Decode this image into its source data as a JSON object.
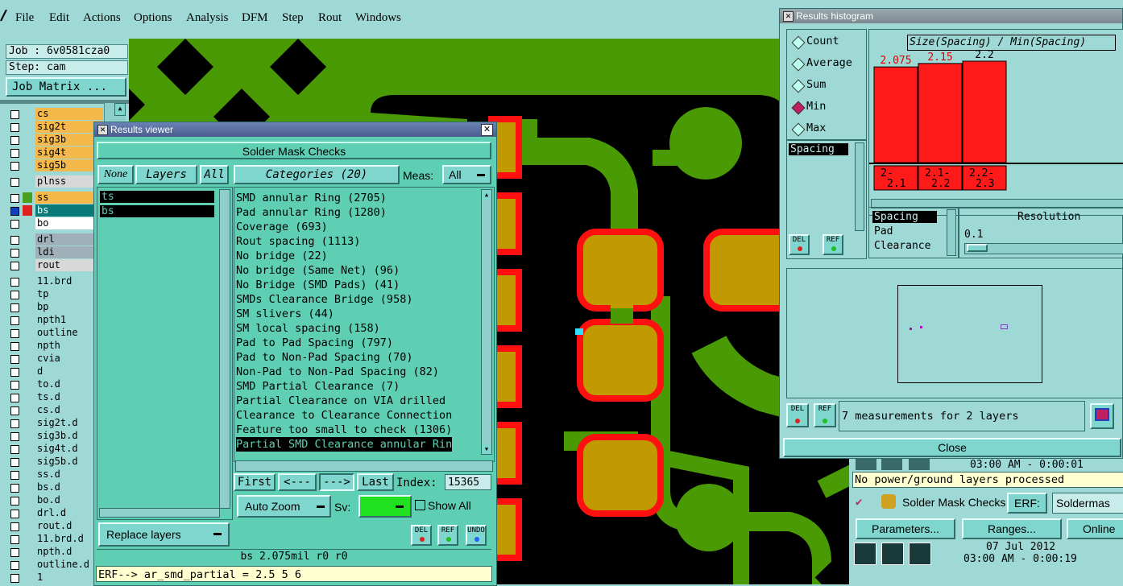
{
  "menubar": {
    "items": [
      "File",
      "Edit",
      "Actions",
      "Options",
      "Analysis",
      "DFM",
      "Step",
      "Rout",
      "Windows"
    ]
  },
  "left_panel": {
    "job": "Job : 6v0581cza0",
    "step": "Step: cam",
    "job_matrix": "Job Matrix ...",
    "layers": [
      {
        "name": "cs",
        "bg": "#f5b84a"
      },
      {
        "name": "sig2t",
        "bg": "#f5b84a"
      },
      {
        "name": "sig3b",
        "bg": "#f5b84a"
      },
      {
        "name": "sig4t",
        "bg": "#f5b84a"
      },
      {
        "name": "sig5b",
        "bg": "#f5b84a"
      },
      {
        "name": "plnss",
        "bg": "#d8d8d8"
      },
      {
        "name": "ss",
        "bg": "#f5b84a",
        "swatch": "#4aa020"
      },
      {
        "name": "bs",
        "bg": "#0a7a78",
        "swatch": "#e02020"
      },
      {
        "name": "bo",
        "bg": "#ffffff"
      },
      {
        "name": "drl",
        "bg": "#a0b0b8"
      },
      {
        "name": "ldi",
        "bg": "#a0b0b8"
      },
      {
        "name": "rout",
        "bg": "#d8d8d8"
      },
      {
        "name": "11.brd",
        "bg": "#9ed9d6"
      },
      {
        "name": "tp",
        "bg": "#9ed9d6"
      },
      {
        "name": "bp",
        "bg": "#9ed9d6"
      },
      {
        "name": "npth1",
        "bg": "#9ed9d6"
      },
      {
        "name": "outline",
        "bg": "#9ed9d6"
      },
      {
        "name": "npth",
        "bg": "#9ed9d6"
      },
      {
        "name": "cvia",
        "bg": "#9ed9d6"
      },
      {
        "name": "d",
        "bg": "#9ed9d6"
      },
      {
        "name": "to.d",
        "bg": "#9ed9d6"
      },
      {
        "name": "ts.d",
        "bg": "#9ed9d6"
      },
      {
        "name": "cs.d",
        "bg": "#9ed9d6"
      },
      {
        "name": "sig2t.d",
        "bg": "#9ed9d6"
      },
      {
        "name": "sig3b.d",
        "bg": "#9ed9d6"
      },
      {
        "name": "sig4t.d",
        "bg": "#9ed9d6"
      },
      {
        "name": "sig5b.d",
        "bg": "#9ed9d6"
      },
      {
        "name": "ss.d",
        "bg": "#9ed9d6"
      },
      {
        "name": "bs.d",
        "bg": "#9ed9d6"
      },
      {
        "name": "bo.d",
        "bg": "#9ed9d6"
      },
      {
        "name": "drl.d",
        "bg": "#9ed9d6"
      },
      {
        "name": "rout.d",
        "bg": "#9ed9d6"
      },
      {
        "name": "11.brd.d",
        "bg": "#9ed9d6"
      },
      {
        "name": "npth.d",
        "bg": "#9ed9d6"
      },
      {
        "name": "outline.d",
        "bg": "#9ed9d6"
      },
      {
        "name": "1",
        "bg": "#9ed9d6"
      }
    ]
  },
  "results_viewer": {
    "title": "Results viewer",
    "header": "Solder Mask Checks",
    "none_btn": "None",
    "layers_btn": "Layers",
    "all_btn": "All",
    "layers": [
      "ts",
      "bs"
    ],
    "categories_btn": "Categories (20)",
    "meas_label": "Meas:",
    "meas_value": "All",
    "categories": [
      "SMD annular Ring (2705)",
      "Pad annular Ring (1280)",
      "Coverage (693)",
      "Rout spacing (1113)",
      "No bridge (22)",
      "No bridge (Same Net) (96)",
      "No Bridge (SMD Pads) (41)",
      "SMDs Clearance Bridge (958)",
      "SM slivers (44)",
      "SM local spacing (158)",
      "Pad to Pad Spacing (797)",
      "Pad to Non-Pad Spacing (70)",
      "Non-Pad to Non-Pad Spacing (82)",
      "SMD Partial Clearance (7)",
      "Partial Clearance on VIA drilled",
      "Clearance to Clearance Connection",
      "Feature too small to check (1306)",
      "Partial SMD Clearance annular Rin"
    ],
    "first": "First",
    "prev": "<---",
    "next": "--->",
    "last": "Last",
    "index_label": "Index:",
    "index_value": "15365",
    "auto_zoom": "Auto Zoom",
    "sv_label": "Sv:",
    "show_all": "Show All",
    "replace_layers": "Replace layers",
    "del": "DEL",
    "ref": "REF",
    "undo": "UNDO",
    "status": "bs 2.075mil  r0  r0",
    "erf": "ERF--> ar_smd_partial = 2.5 5 6"
  },
  "histogram": {
    "title": "Results histogram",
    "modes": [
      "Count",
      "Average",
      "Sum",
      "Min",
      "Max"
    ],
    "selected_mode": "Min",
    "attr_list": [
      "Spacing"
    ],
    "chart_title": "Size(Spacing) / Min(Spacing)",
    "chart_data": {
      "type": "bar",
      "categories": [
        "2-2.1",
        "2.1-2.2",
        "2.2-2.3"
      ],
      "values": [
        2.075,
        2.15,
        2.2
      ],
      "value_labels": [
        "2.075",
        "2.15",
        "2.2"
      ],
      "bin_labels": [
        [
          "2-",
          "2.1"
        ],
        [
          "2.1-",
          "2.2"
        ],
        [
          "2.2-",
          "2.3"
        ]
      ]
    },
    "sizes": [
      "Spacing",
      "Pad",
      "Clearance"
    ],
    "resolution_label": "Resolution",
    "resolution_value": "0.1",
    "del": "DEL",
    "ref": "REF",
    "measurements": "7 measurements for 2 layers",
    "close": "Close"
  },
  "right_under": {
    "time_top": "03:00 AM - 0:00:01",
    "no_power": "No power/ground layers processed",
    "check_name": "Solder Mask Checks",
    "erf_label": "ERF:",
    "erf_value": "Soldermas",
    "parameters": "Parameters...",
    "ranges": "Ranges...",
    "online": "Online",
    "date": "07 Jul 2012",
    "time_bottom": "03:00 AM - 0:00:19"
  }
}
